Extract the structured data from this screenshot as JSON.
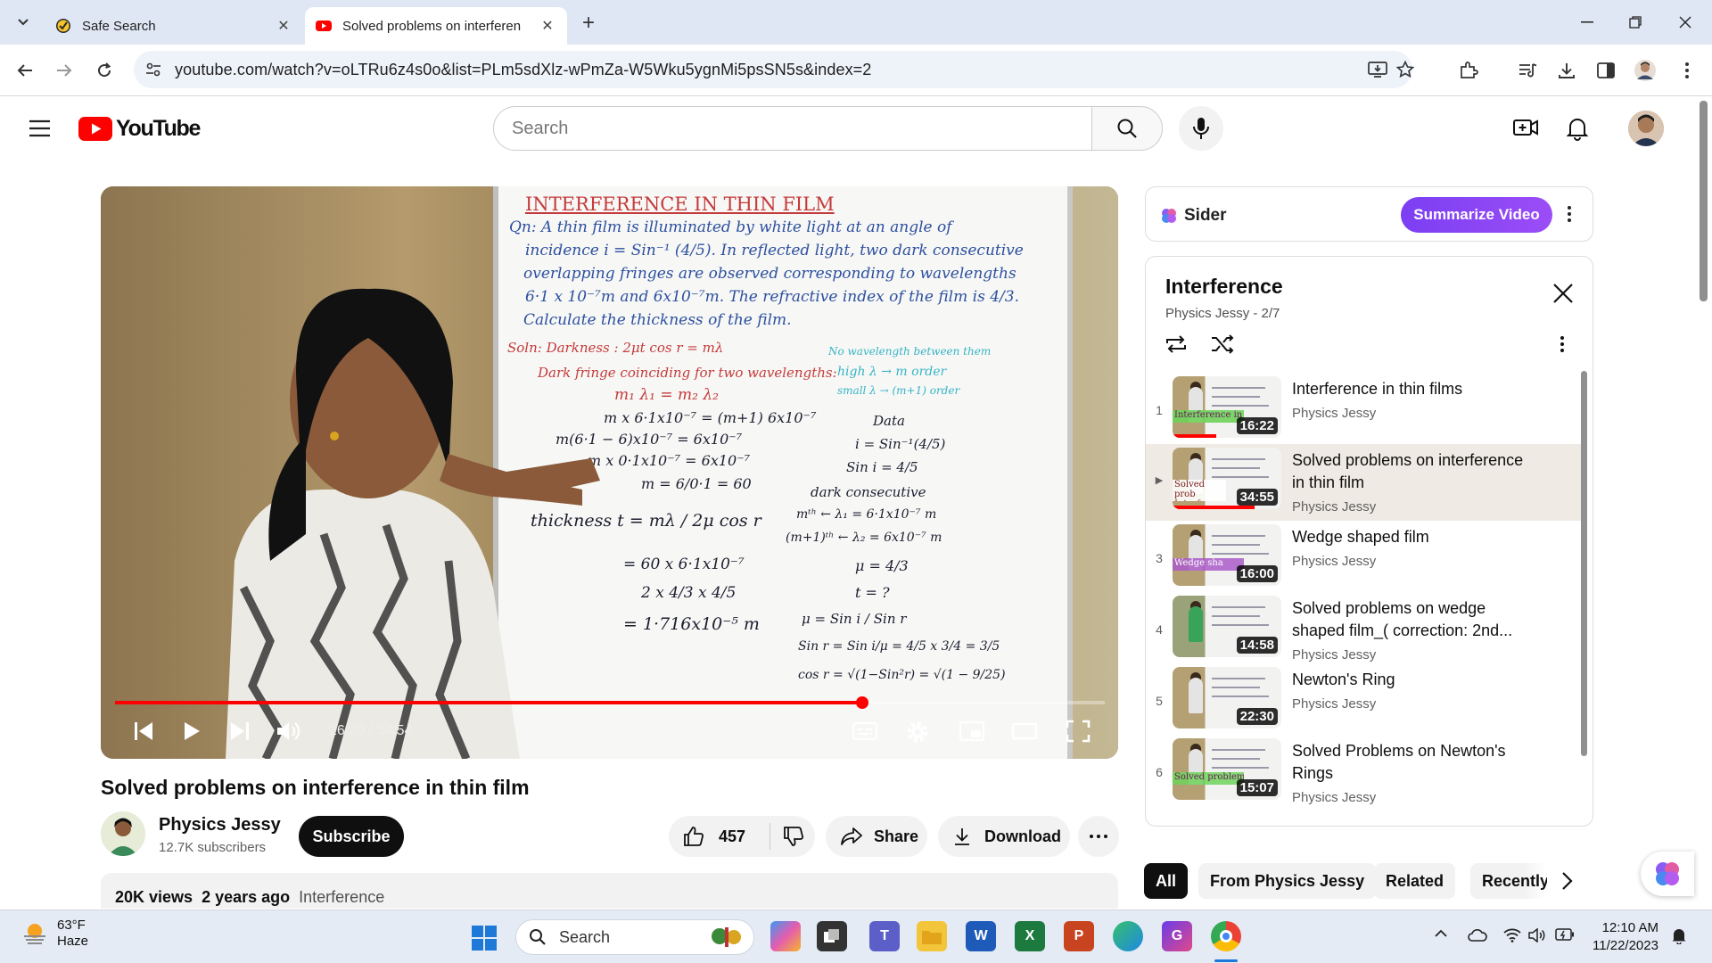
{
  "browser": {
    "tabs": [
      {
        "title": "Safe Search",
        "favicon": "safe-search-check-icon"
      },
      {
        "title": "Solved problems on interferen",
        "favicon": "youtube-favicon",
        "active": true
      }
    ],
    "url": "youtube.com/watch?v=oLTRu6z4s0o&list=PLm5sdXlz-wPmZa-W5Wku5ygnMi5psSN5s&index=2"
  },
  "youtube": {
    "logo_text": "YouTube",
    "search_placeholder": "Search"
  },
  "player": {
    "time_current": "26:20 / 34:54",
    "progress_fraction": 0.755,
    "board": {
      "heading": "INTERFERENCE  IN  THIN  FILM",
      "q1": "Qn: A thin film is illuminated by white light at an angle of",
      "q2": "incidence  i = Sin⁻¹ (4/5).  In reflected light, two dark consecutive",
      "q3": "overlapping fringes are observed corresponding to wavelengths",
      "q4": "6·1 x 10⁻⁷m  and  6x10⁻⁷m.  The refractive index of the film is 4/3.",
      "q5": "Calculate the thickness of the film.",
      "sol": "Soln:  Darkness :  2μt cos r = mλ",
      "dark": "Dark fringe coinciding for two wavelengths:",
      "eq1": "m₁ λ₁ = m₂ λ₂",
      "eq2": "m x 6·1x10⁻⁷ = (m+1) 6x10⁻⁷",
      "eq3": "m(6·1 − 6)x10⁻⁷ = 6x10⁻⁷",
      "eq4": "m x 0·1x10⁻⁷ = 6x10⁻⁷",
      "eq5": "m = 6/0·1 = 60",
      "th1": "thickness   t = mλ / 2μ cos r",
      "th2": "= 60 x 6·1x10⁻⁷",
      "th3": "2 x 4/3 x 4/5",
      "th4": "= 1·716x10⁻⁵ m",
      "note1": "No wavelength between them",
      "note2": "high λ → m order",
      "note3": "small λ → (m+1) order",
      "data1": "Data",
      "data2": "i = Sin⁻¹(4/5)",
      "data3": "Sin i = 4/5",
      "data4": "dark consecutive",
      "data5": "mᵗʰ ← λ₁ = 6·1x10⁻⁷ m",
      "data6": "(m+1)ᵗʰ ← λ₂ = 6x10⁻⁷ m",
      "data7": "μ = 4/3",
      "data8": "t = ?",
      "data9": "μ = Sin i / Sin r",
      "data10": "Sin r = Sin i/μ = 4/5 x 3/4 = 3/5",
      "data11": "cos r = √(1−Sin²r) = √(1 − 9/25)"
    }
  },
  "video": {
    "title": "Solved problems on interference in thin film",
    "channel": "Physics Jessy",
    "subscribers": "12.7K subscribers",
    "subscribe_label": "Subscribe",
    "likes": "457",
    "share_label": "Share",
    "download_label": "Download",
    "views": "20K views",
    "age": "2 years ago",
    "tag": "Interference"
  },
  "sider": {
    "name": "Sider",
    "summarize_label": "Summarize Video"
  },
  "playlist": {
    "title": "Interference",
    "subtitle": "Physics Jessy - 2/7",
    "items": [
      {
        "index": "1",
        "title": "Interference in thin films",
        "channel": "Physics Jessy",
        "duration": "16:22",
        "thumb_text": "Interference in thin fil",
        "watched_fraction": 0.4
      },
      {
        "index": "▶",
        "title": "Solved problems on interference in thin film",
        "channel": "Physics Jessy",
        "duration": "34:55",
        "thumb_text": "Solved prob Interference i",
        "watched_fraction": 0.75,
        "active": true
      },
      {
        "index": "3",
        "title": "Wedge shaped film",
        "channel": "Physics Jessy",
        "duration": "16:00",
        "thumb_text": "Wedge sha",
        "watched_fraction": 0
      },
      {
        "index": "4",
        "title": "Solved problems on wedge shaped film_( correction: 2nd...",
        "channel": "Physics Jessy",
        "duration": "14:58",
        "thumb_text": "",
        "watched_fraction": 0
      },
      {
        "index": "5",
        "title": "Newton's Ring",
        "channel": "Physics Jessy",
        "duration": "22:30",
        "thumb_text": "",
        "watched_fraction": 0
      },
      {
        "index": "6",
        "title": "Solved Problems on Newton's Rings",
        "channel": "Physics Jessy",
        "duration": "15:07",
        "thumb_text": "Solved problems o",
        "watched_fraction": 0
      }
    ]
  },
  "chips": [
    "All",
    "From Physics Jessy",
    "Related",
    "Recently"
  ],
  "taskbar": {
    "temperature": "63°F",
    "weather": "Haze",
    "search_label": "Search",
    "time": "12:10 AM",
    "date": "11/22/2023"
  },
  "colors": {
    "youtube_red": "#ff0000",
    "sider_purple": "#7b3ff2",
    "chrome_tabbar": "#dfe7f4"
  }
}
